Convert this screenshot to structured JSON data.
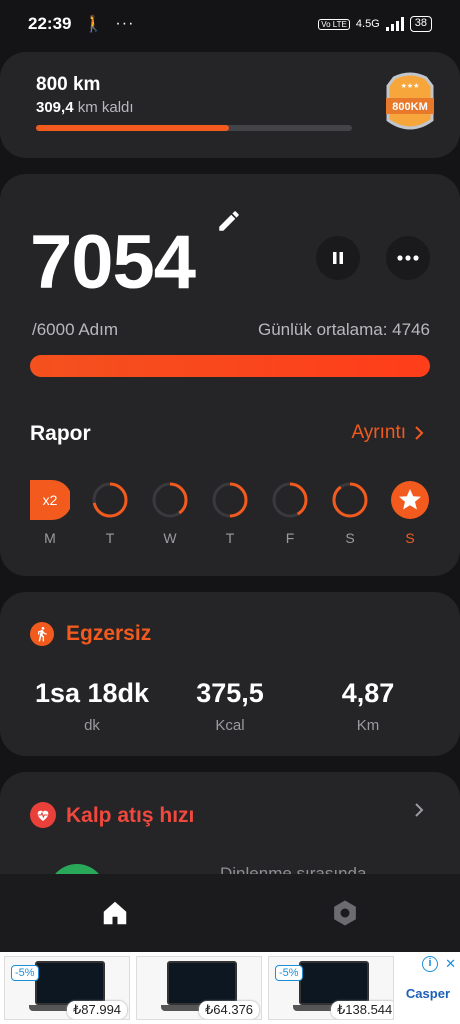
{
  "status_bar": {
    "time": "22:39",
    "network": "4.5G",
    "volte": "Vo LTE",
    "battery": "38"
  },
  "goal_card": {
    "title": "800 km",
    "remaining_value": "309,4",
    "remaining_suffix": "km kaldı",
    "progress": 0.61,
    "badge_text": "800KM"
  },
  "steps_card": {
    "steps": "7054",
    "goal": "/6000 Adım",
    "daily_average": "Günlük ortalama: 4746",
    "progress": 1.0,
    "report_title": "Rapor",
    "detail_link": "Ayrıntı",
    "days": [
      {
        "label": "M",
        "multiplier": "x2",
        "progress": 1.0
      },
      {
        "label": "T",
        "progress": 0.72
      },
      {
        "label": "W",
        "progress": 0.4
      },
      {
        "label": "T",
        "progress": 0.5
      },
      {
        "label": "F",
        "progress": 0.42
      },
      {
        "label": "S",
        "progress": 0.9
      },
      {
        "label": "S",
        "progress": 1.0,
        "today": true
      }
    ]
  },
  "exercise_card": {
    "title": "Egzersiz",
    "metrics": [
      {
        "value": "1sa 18dk",
        "unit": "dk"
      },
      {
        "value": "375,5",
        "unit": "Kcal"
      },
      {
        "value": "4,87",
        "unit": "Km"
      }
    ]
  },
  "heart_card": {
    "title": "Kalp atış hızı",
    "partial_text": "Dinlenme sırasında"
  },
  "ad": {
    "items": [
      {
        "discount": "-5%",
        "price": "₺87.994"
      },
      {
        "discount": "",
        "price": "₺64.376"
      },
      {
        "discount": "-5%",
        "price": "₺138.544"
      }
    ],
    "brand": "Casper"
  },
  "colors": {
    "accent": "#f25a1e",
    "card": "#252528",
    "background": "#141416",
    "heart": "#f0483c"
  }
}
